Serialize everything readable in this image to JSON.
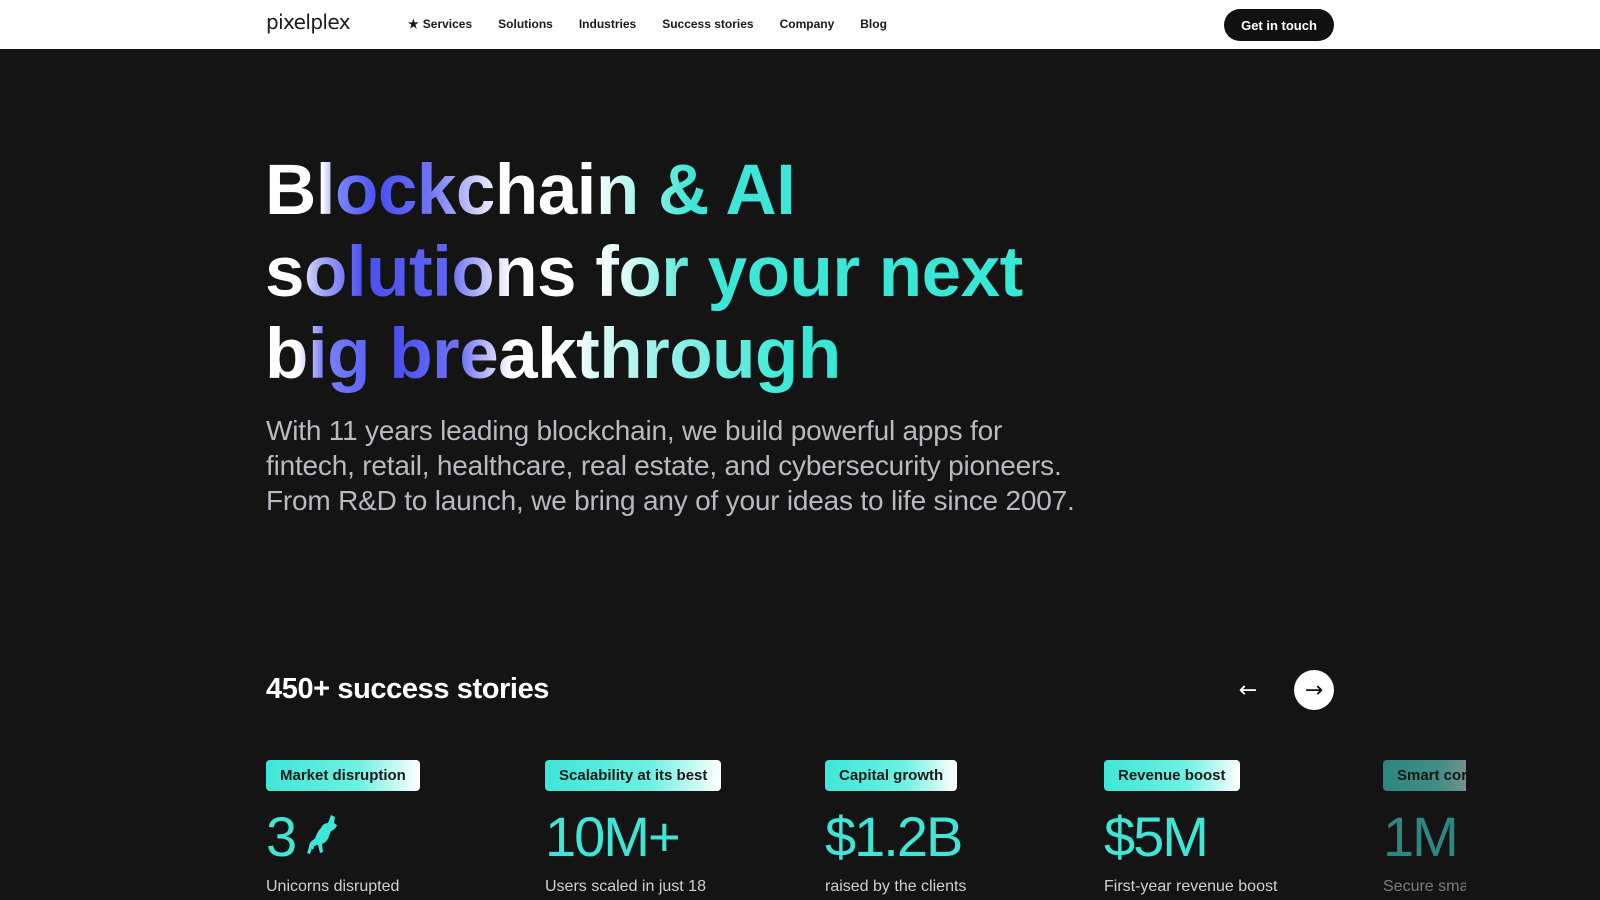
{
  "header": {
    "logo": "pixelplex",
    "nav": [
      "Services",
      "Solutions",
      "Industries",
      "Success stories",
      "Company",
      "Blog"
    ],
    "cta": "Get in touch"
  },
  "hero": {
    "title_lines": [
      "Blockchain & AI",
      "solutions for your next",
      "big breakthrough"
    ],
    "subtitle": "With 11 years leading blockchain, we build powerful apps for fintech, retail, healthcare, real estate, and cybersecurity pioneers. From R&D to launch, we bring any of your ideas to life since 2007."
  },
  "stories": {
    "title": "450+ success stories",
    "prev_icon": "arrow-left-icon",
    "next_icon": "arrow-right-icon",
    "cards": [
      {
        "tag": "Market disruption",
        "stat": "3",
        "icon": "unicorn-icon",
        "desc": "Unicorns disrupted"
      },
      {
        "tag": "Scalability at its best",
        "stat": "10M+",
        "desc": "Users scaled in just 18"
      },
      {
        "tag": "Capital growth",
        "stat": "$1.2B",
        "desc": "raised by the clients"
      },
      {
        "tag": "Revenue boost",
        "stat": "$5M",
        "desc": "First-year revenue boost"
      },
      {
        "tag": "Smart cor",
        "stat": "1M",
        "desc": "Secure smar"
      }
    ]
  },
  "colors": {
    "accent_teal": "#3fe6d7",
    "accent_indigo": "#4b4ff2",
    "background": "#141414"
  }
}
